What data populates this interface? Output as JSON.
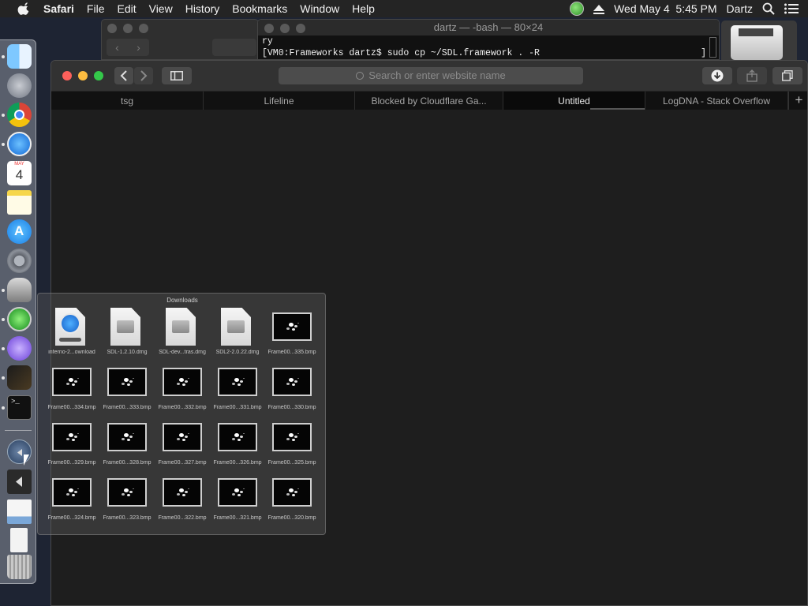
{
  "menubar": {
    "app": "Safari",
    "items": [
      "File",
      "Edit",
      "View",
      "History",
      "Bookmarks",
      "Window",
      "Help"
    ],
    "clock": "Wed May 4  5:45 PM",
    "user": "Dartz"
  },
  "terminal": {
    "title": "dartz — -bash — 80×24",
    "lines": [
      "ry",
      "[VM0:Frameworks dartz$ sudo cp ~/SDL.framework . -R"
    ],
    "cursor_glyph": "]"
  },
  "safari": {
    "search_placeholder": "Search or enter website name",
    "tabs": [
      {
        "label": "tsg"
      },
      {
        "label": "Lifeline"
      },
      {
        "label": "Blocked by Cloudflare Ga..."
      },
      {
        "label": "Untitled"
      },
      {
        "label": "LogDNA - Stack Overflow"
      }
    ],
    "new_tab_glyph": "+"
  },
  "dock": {
    "items": [
      "finder-icon",
      "launchpad-icon",
      "chrome-icon",
      "safari-icon",
      "calendar-icon",
      "notes-icon",
      "app-store-icon",
      "system-preferences-icon",
      "automator-icon",
      "green-app-icon",
      "bittorrent-icon",
      "console-icon",
      "terminal-icon"
    ],
    "calendar_month": "MAY",
    "calendar_day": "4"
  },
  "downloads": {
    "title": "Downloads",
    "items": [
      {
        "label": "inferno-2...ownload",
        "kind": "safari-download"
      },
      {
        "label": "SDL-1.2.10.dmg",
        "kind": "dmg"
      },
      {
        "label": "SDL-dev...tras.dmg",
        "kind": "dmg"
      },
      {
        "label": "SDL2-2.0.22.dmg",
        "kind": "dmg"
      },
      {
        "label": "Frame00...335.bmp",
        "kind": "bmp"
      },
      {
        "label": "Frame00...334.bmp",
        "kind": "bmp"
      },
      {
        "label": "Frame00...333.bmp",
        "kind": "bmp"
      },
      {
        "label": "Frame00...332.bmp",
        "kind": "bmp"
      },
      {
        "label": "Frame00...331.bmp",
        "kind": "bmp"
      },
      {
        "label": "Frame00...330.bmp",
        "kind": "bmp"
      },
      {
        "label": "Frame00...329.bmp",
        "kind": "bmp"
      },
      {
        "label": "Frame00...328.bmp",
        "kind": "bmp"
      },
      {
        "label": "Frame00...327.bmp",
        "kind": "bmp"
      },
      {
        "label": "Frame00...326.bmp",
        "kind": "bmp"
      },
      {
        "label": "Frame00...325.bmp",
        "kind": "bmp"
      },
      {
        "label": "Frame00...324.bmp",
        "kind": "bmp"
      },
      {
        "label": "Frame00...323.bmp",
        "kind": "bmp"
      },
      {
        "label": "Frame00...322.bmp",
        "kind": "bmp"
      },
      {
        "label": "Frame00...321.bmp",
        "kind": "bmp"
      },
      {
        "label": "Frame00...320.bmp",
        "kind": "bmp"
      }
    ]
  }
}
